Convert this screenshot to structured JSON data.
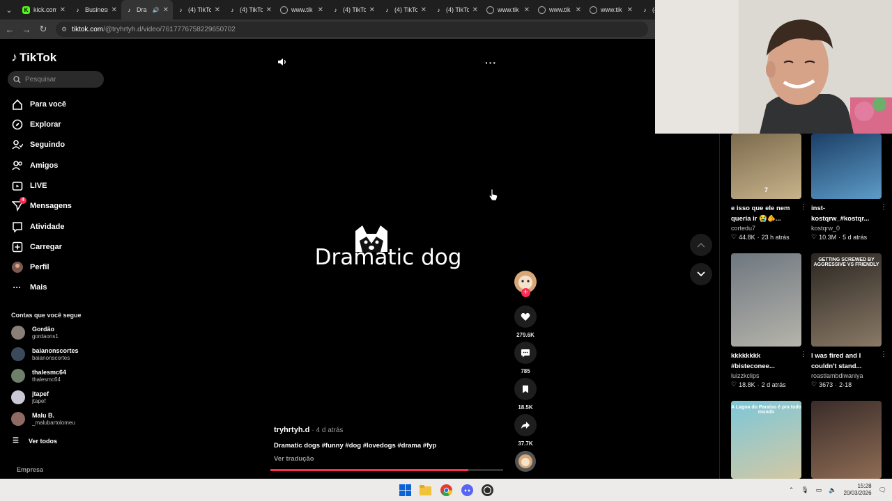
{
  "browser": {
    "tabs": [
      {
        "label": "kick.com",
        "favicon": "kick",
        "active": false
      },
      {
        "label": "Business",
        "favicon": "tiktok",
        "active": false
      },
      {
        "label": "Dra",
        "favicon": "tiktok",
        "active": true,
        "audio": true
      },
      {
        "label": "(4) TikTok",
        "favicon": "tiktok",
        "active": false
      },
      {
        "label": "(4) TikTok",
        "favicon": "tiktok",
        "active": false
      },
      {
        "label": "www.tik",
        "favicon": "globe",
        "active": false
      },
      {
        "label": "(4) TikTok",
        "favicon": "tiktok",
        "active": false
      },
      {
        "label": "(4) TikTok",
        "favicon": "tiktok",
        "active": false
      },
      {
        "label": "(4) TikTok",
        "favicon": "tiktok",
        "active": false
      },
      {
        "label": "www.tik",
        "favicon": "globe",
        "active": false
      },
      {
        "label": "www.tik",
        "favicon": "globe",
        "active": false
      },
      {
        "label": "www.tik",
        "favicon": "globe",
        "active": false
      },
      {
        "label": "(4",
        "favicon": "tiktok",
        "active": false
      }
    ],
    "url_host": "tiktok.com",
    "url_path": "/@tryhrtyh.d/video/7617776758229650702"
  },
  "sidebar": {
    "logo": "TikTok",
    "search_placeholder": "Pesquisar",
    "nav": [
      {
        "label": "Para você",
        "icon": "home-icon"
      },
      {
        "label": "Explorar",
        "icon": "compass-icon"
      },
      {
        "label": "Seguindo",
        "icon": "following-icon"
      },
      {
        "label": "Amigos",
        "icon": "friends-icon"
      },
      {
        "label": "LIVE",
        "icon": "live-icon"
      },
      {
        "label": "Mensagens",
        "icon": "messages-icon",
        "badge": "4"
      },
      {
        "label": "Atividade",
        "icon": "activity-icon"
      },
      {
        "label": "Carregar",
        "icon": "upload-icon"
      },
      {
        "label": "Perfil",
        "icon": "profile-avatar"
      },
      {
        "label": "Mais",
        "icon": "more-icon"
      }
    ],
    "following_title": "Contas que você segue",
    "following": [
      {
        "name": "Gordão",
        "handle": "gordaons1",
        "color": "#8a7f77"
      },
      {
        "name": "baianonscortes",
        "handle": "baianonscortes",
        "color": "#3b4a5a"
      },
      {
        "name": "thalesmc64",
        "handle": "thalesmc64",
        "color": "#6e7f6a"
      },
      {
        "name": "jtapef",
        "handle": "jtapef",
        "color": "#c9c9d6"
      },
      {
        "name": "Malu B.",
        "handle": "_malubartolomeu",
        "color": "#8e6a62"
      }
    ],
    "see_all": "Ver todos",
    "footer": "Empresa"
  },
  "video": {
    "title": "Dramatic dog",
    "author": "tryhrtyh.d",
    "posted_ago": "4 d atrás",
    "caption": "Dramatic dogs #funny #dog #lovedogs #drama #fyp",
    "translate": "Ver tradução",
    "progress": 0.85
  },
  "actions": {
    "likes": "279.6K",
    "comments": "785",
    "saves": "18.5K",
    "shares": "37.7K"
  },
  "recommended": [
    {
      "title": "e isso que ele nem queria ir 😭🫵...",
      "user": "cortedu7",
      "likes": "44.8K",
      "ago": "23 h atrás",
      "overlay": "7",
      "colors": [
        "#7c6b4e",
        "#c8b38a"
      ]
    },
    {
      "title": "inst-kostqrw_#kostqr...",
      "user": "kostqrw_0",
      "likes": "10.3M",
      "ago": "5 d atrás",
      "overlay": "",
      "colors": [
        "#1c3f66",
        "#5d9cc8"
      ]
    },
    {
      "title": "kkkkkkkk #bisteconee...",
      "user": "luizzkclips",
      "likes": "18.8K",
      "ago": "2 d atrás",
      "overlay": "",
      "colors": [
        "#6e7780",
        "#b6b4ab"
      ]
    },
    {
      "title": "I was fired and I couldn't stand...",
      "user": "roastlambdiwaniya",
      "likes": "3673",
      "ago": "2-18",
      "overlay": "GETTING SCREWED BY AGGRESSIVE VS FRIENDLY",
      "colors": [
        "#2a2622",
        "#8a7a66"
      ]
    },
    {
      "title": "",
      "user": "",
      "likes": "",
      "ago": "",
      "overlay": "A Lagoa do Paraíso é pra todo mundo",
      "colors": [
        "#7dc7d9",
        "#d2c8a4"
      ]
    },
    {
      "title": "",
      "user": "",
      "likes": "",
      "ago": "",
      "overlay": "",
      "colors": [
        "#3a2c2a",
        "#8e6c54"
      ]
    }
  ],
  "taskbar": {
    "time": "15:28",
    "date": "20/03/2026"
  }
}
